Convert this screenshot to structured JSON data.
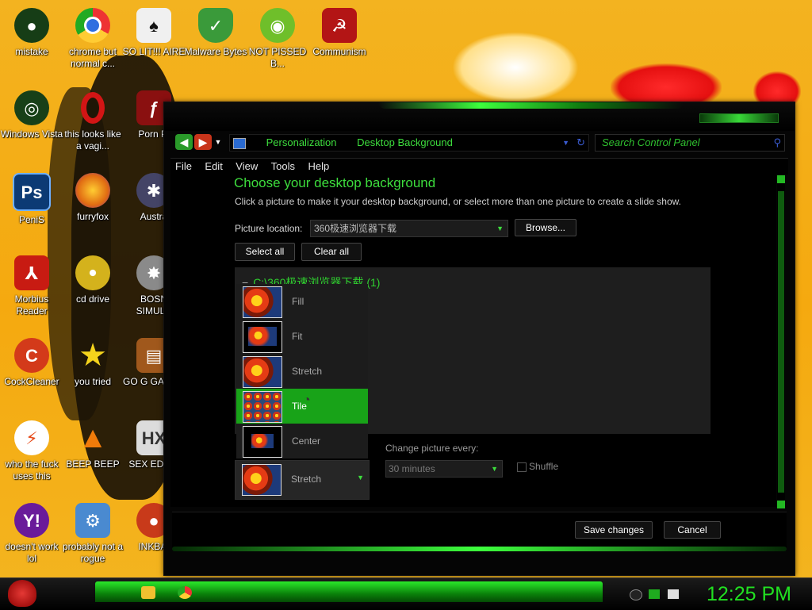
{
  "desktop_icons": [
    {
      "label": "mistake",
      "icon": "green-circle-icon",
      "color": "#163d16"
    },
    {
      "label": "chrome but normal c...",
      "icon": "chrome-icon",
      "color": "#2f6fe0"
    },
    {
      "label": "SO LIT!!! AIRE",
      "icon": "cards-icon",
      "color": "#dcdcdc"
    },
    {
      "label": "Malware Bytes",
      "icon": "shield-icon",
      "color": "#3a9a3a"
    },
    {
      "label": "NOT PISSED B...",
      "icon": "pig-icon",
      "color": "#6fbf2a"
    },
    {
      "label": "Communism",
      "icon": "flag-icon",
      "color": "#b31515"
    },
    {
      "label": "Windows Vista",
      "icon": "green-orb-icon",
      "color": "#184018"
    },
    {
      "label": "this looks like a vagi...",
      "icon": "opera-icon",
      "color": "#d21515"
    },
    {
      "label": "Porn Pl",
      "icon": "flash-icon",
      "color": "#8a1010"
    },
    {
      "label": "PeniS",
      "icon": "photoshop-icon",
      "color": "#0c3a74"
    },
    {
      "label": "furryfox",
      "icon": "firefox-icon",
      "color": "#e06b12"
    },
    {
      "label": "Austra",
      "icon": "spider-icon",
      "color": "#444466"
    },
    {
      "label": "Morbius Reader",
      "icon": "pdf-icon",
      "color": "#c81b12"
    },
    {
      "label": "cd drive",
      "icon": "disc-icon",
      "color": "#d4b21c"
    },
    {
      "label": "BOSN SIMULA",
      "icon": "spiky-ball-icon",
      "color": "#8a8a8a"
    },
    {
      "label": "CockCleaner",
      "icon": "ccleaner-icon",
      "color": "#d33a1a"
    },
    {
      "label": "you tried",
      "icon": "star-icon",
      "color": "#f5d31c"
    },
    {
      "label": "GO G GADGE",
      "icon": "briefcase-icon",
      "color": "#a0581c"
    },
    {
      "label": "who the fuck uses this",
      "icon": "lightning-icon",
      "color": "#e64a19"
    },
    {
      "label": "BEEP BEEP",
      "icon": "vlc-icon",
      "color": "#f07b0a"
    },
    {
      "label": "SEX EDITC",
      "icon": "hex-icon",
      "color": "#dcdcdc"
    },
    {
      "label": "doesn't work lol",
      "icon": "yahoo-icon",
      "color": "#6a1b9a"
    },
    {
      "label": "probably not a rogue",
      "icon": "gears-icon",
      "color": "#4a8ad0"
    },
    {
      "label": "INKBAI",
      "icon": "pin-icon",
      "color": "#c83a1a"
    }
  ],
  "window": {
    "breadcrumb": [
      "Personalization",
      "Desktop Background"
    ],
    "search_placeholder": "Search Control Panel",
    "menu": [
      "File",
      "Edit",
      "View",
      "Tools",
      "Help"
    ],
    "heading": "Choose your desktop background",
    "subheading": "Click a picture to make it your desktop background, or select more than one picture to create a slide show.",
    "picture_location_label": "Picture location:",
    "picture_location_value": "360极速浏览器下载",
    "browse_label": "Browse...",
    "select_all_label": "Select all",
    "clear_all_label": "Clear all",
    "folder_label": "C:\\360极速浏览器下载 (1)",
    "change_picture_label": "Change picture every:",
    "change_picture_value": "30 minutes",
    "shuffle_label": "Shuffle",
    "save_label": "Save changes",
    "cancel_label": "Cancel",
    "accent_color": "#3ddd3d"
  },
  "position_menu": {
    "items": [
      "Fill",
      "Fit",
      "Stretch",
      "Tile",
      "Center"
    ],
    "selected": "Tile",
    "current_value": "Stretch"
  },
  "taskbar": {
    "clock": "12:25 PM"
  }
}
